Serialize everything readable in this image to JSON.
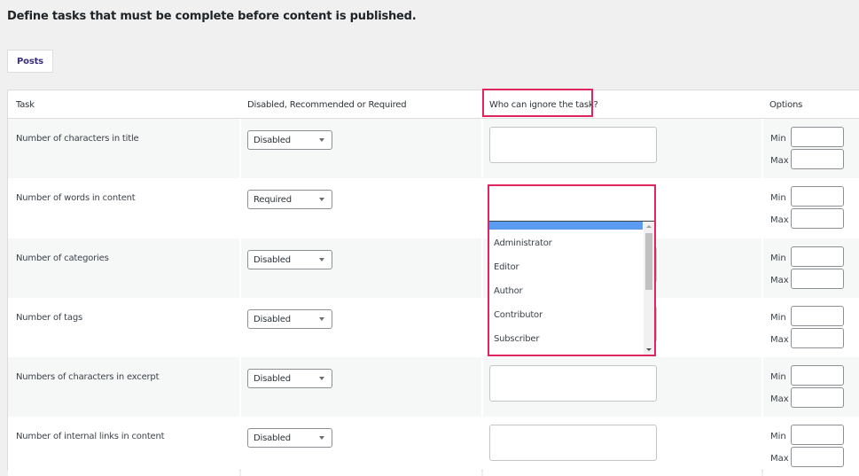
{
  "intro_text": "Define tasks that must be complete before content is published.",
  "tabs": [
    {
      "label": "Posts",
      "active": true
    }
  ],
  "table": {
    "headers": [
      "Task",
      "Disabled, Recommended or Required",
      "Who can ignore the task?",
      "Options"
    ],
    "rows": [
      {
        "task": "Number of characters in title",
        "status": "Disabled",
        "ignore": [],
        "min_label": "Min",
        "max_label": "Max",
        "min": "",
        "max": ""
      },
      {
        "task": "Number of words in content",
        "status": "Required",
        "ignore": [],
        "min_label": "Min",
        "max_label": "Max",
        "min": "",
        "max": ""
      },
      {
        "task": "Number of categories",
        "status": "Disabled",
        "ignore": [],
        "min_label": "Min",
        "max_label": "Max",
        "min": "",
        "max": ""
      },
      {
        "task": "Number of tags",
        "status": "Disabled",
        "ignore": [],
        "min_label": "Min",
        "max_label": "Max",
        "min": "",
        "max": ""
      },
      {
        "task": "Numbers of characters in excerpt",
        "status": "Disabled",
        "ignore": [],
        "min_label": "Min",
        "max_label": "Max",
        "min": "",
        "max": ""
      },
      {
        "task": "Number of internal links in content",
        "status": "Disabled",
        "ignore": [],
        "min_label": "Min",
        "max_label": "Max",
        "min": "",
        "max": ""
      }
    ]
  },
  "role_dropdown": {
    "open_for_row": 1,
    "options": [
      "Administrator",
      "Editor",
      "Author",
      "Contributor",
      "Subscriber"
    ]
  },
  "colors": {
    "highlight": "#e0245e",
    "selection": "#5b9cf2",
    "tab_text": "#3c2f7a",
    "row_alt": "#f6f7f7",
    "page_bg": "#f0f0f1"
  }
}
